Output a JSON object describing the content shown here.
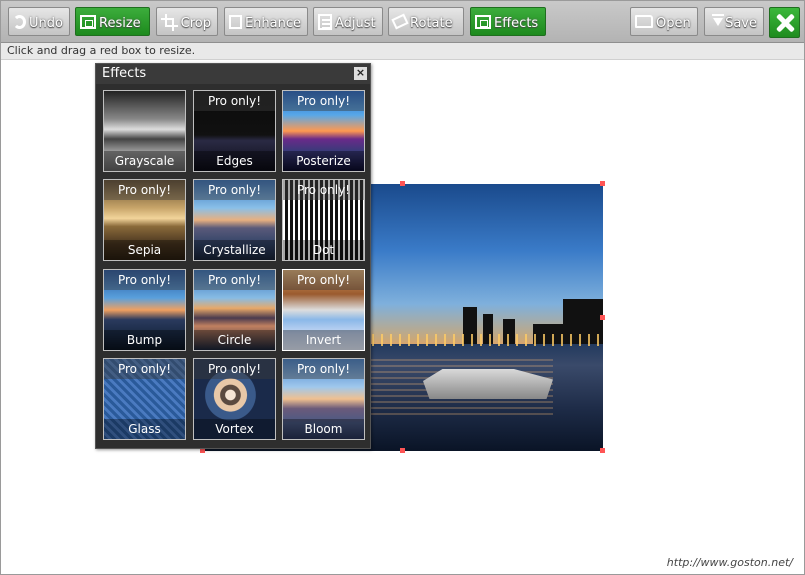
{
  "toolbar": {
    "undo": "Undo",
    "resize": "Resize",
    "crop": "Crop",
    "enhance": "Enhance",
    "adjust": "Adjust",
    "rotate": "Rotate",
    "effects": "Effects",
    "open": "Open",
    "save": "Save"
  },
  "hint": "Click and drag a red box to resize.",
  "panel": {
    "title": "Effects",
    "close": "×",
    "pro_label": "Pro only!",
    "effects": [
      {
        "name": "Grayscale",
        "pro": false
      },
      {
        "name": "Edges",
        "pro": true
      },
      {
        "name": "Posterize",
        "pro": true
      },
      {
        "name": "Sepia",
        "pro": true
      },
      {
        "name": "Crystallize",
        "pro": true
      },
      {
        "name": "Dot",
        "pro": true
      },
      {
        "name": "Bump",
        "pro": true
      },
      {
        "name": "Circle",
        "pro": true
      },
      {
        "name": "Invert",
        "pro": true
      },
      {
        "name": "Glass",
        "pro": true
      },
      {
        "name": "Vortex",
        "pro": true
      },
      {
        "name": "Bloom",
        "pro": true
      }
    ]
  },
  "watermark": "http://www.goston.net/",
  "colors": {
    "active_button": "#2a9a2a",
    "handle": "#ff5555",
    "panel_bg": "#2e2e2e"
  }
}
